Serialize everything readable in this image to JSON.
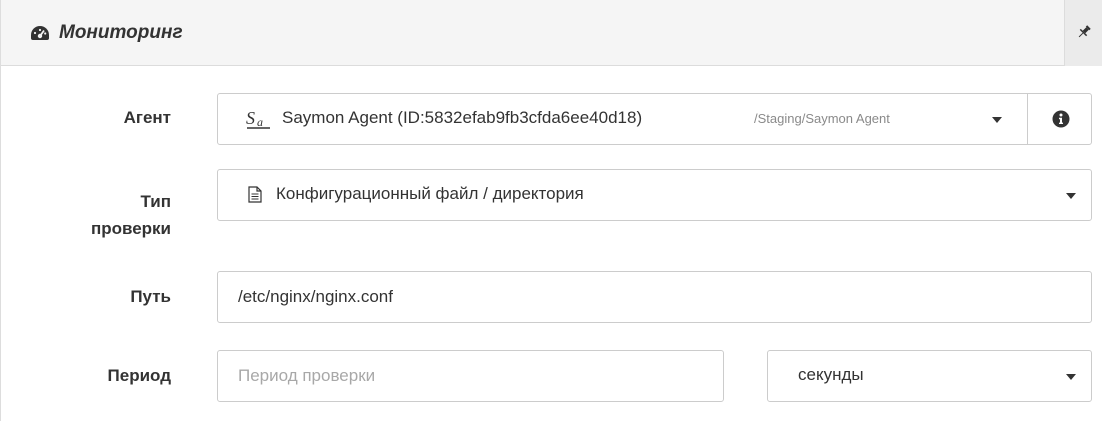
{
  "panel": {
    "title": "Мониторинг",
    "header_icon": "tachometer-icon",
    "pin_icon": "pin-icon"
  },
  "form": {
    "agent": {
      "label": "Агент",
      "icon": "saymon-agent-icon",
      "selected_name": "Saymon Agent (ID:5832efab9fb3cfda6ee40d18)",
      "selected_path": "/Staging/Saymon Agent",
      "info_icon": "info-circle-icon"
    },
    "check_type": {
      "label_line1": "Тип",
      "label_line2": "проверки",
      "icon": "document-icon",
      "selected": "Конфигурационный файл / директория"
    },
    "path": {
      "label": "Путь",
      "value": "/etc/nginx/nginx.conf"
    },
    "period": {
      "label": "Период",
      "placeholder": "Период проверки",
      "unit": "секунды"
    }
  },
  "colors": {
    "header_bg": "#f5f5f5",
    "border": "#cccccc",
    "text": "#333333",
    "muted": "#8a8a8a",
    "placeholder": "#a8a8a8"
  }
}
